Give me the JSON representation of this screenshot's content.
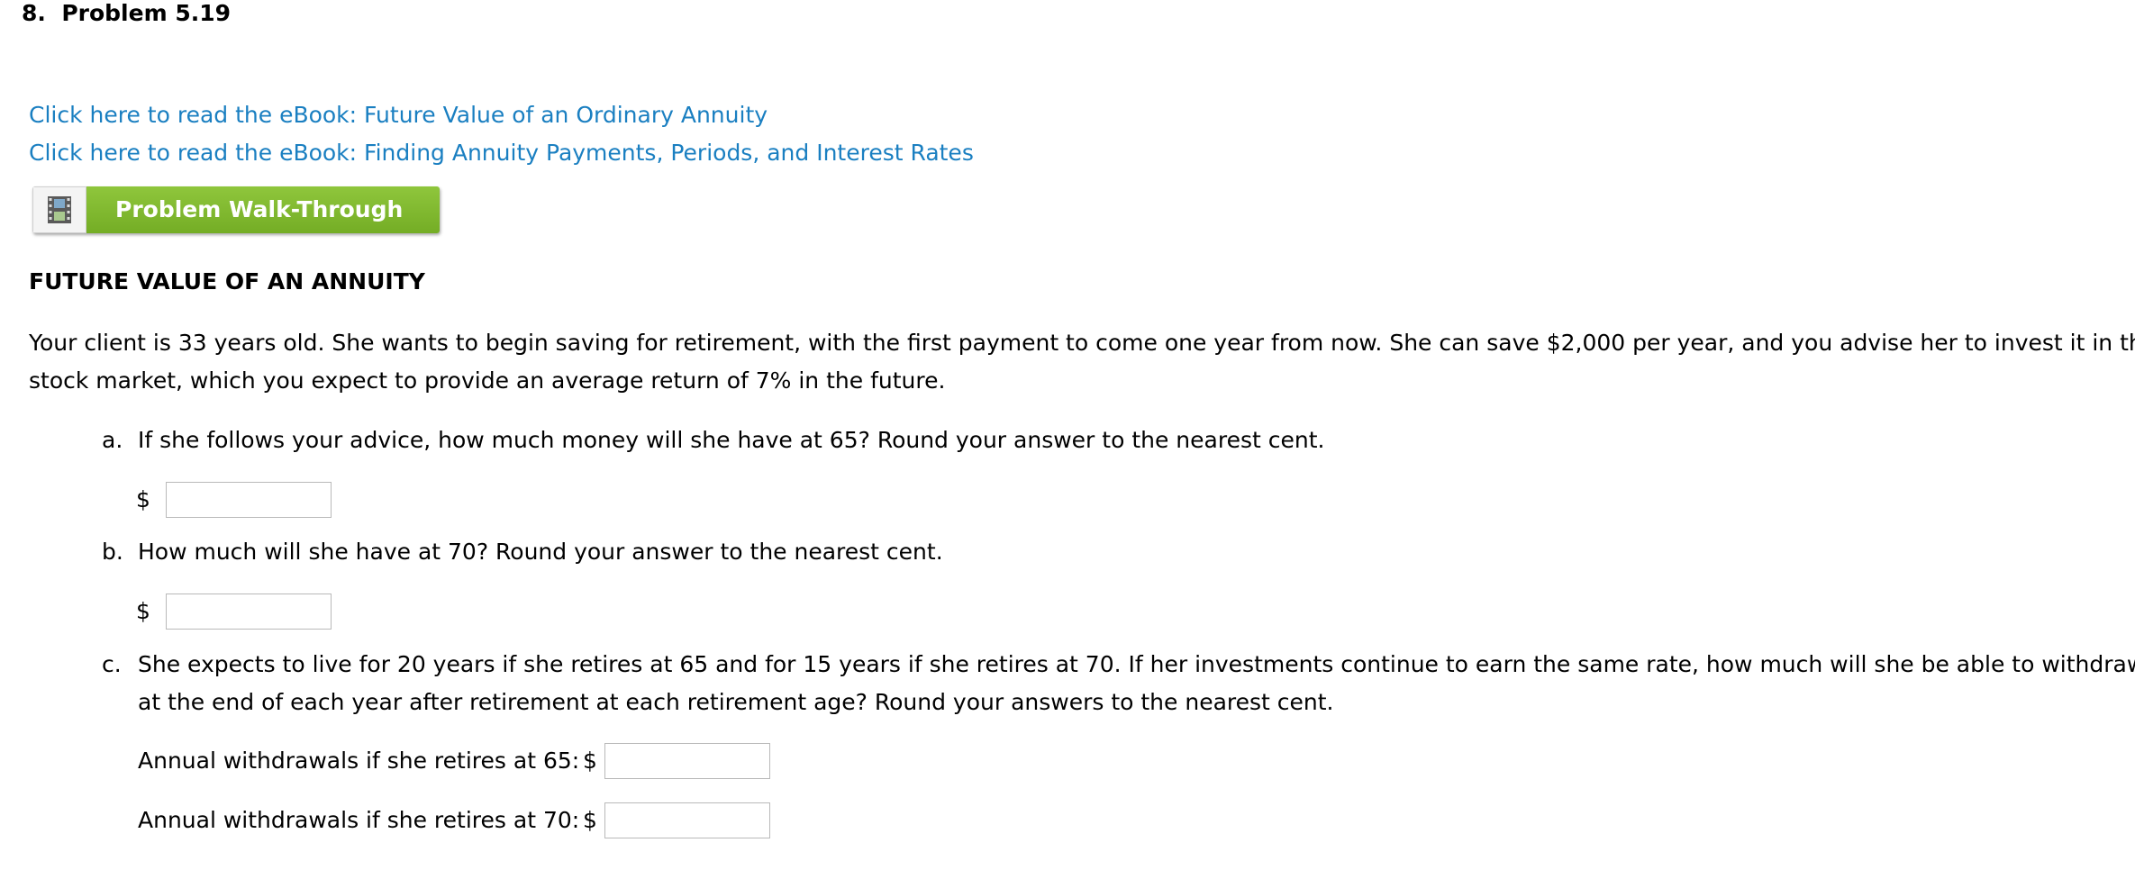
{
  "problem": {
    "number": "8.",
    "title": "Problem 5.19"
  },
  "links": [
    {
      "label": "Click here to read the eBook: Future Value of an Ordinary Annuity"
    },
    {
      "label": "Click here to read the eBook: Finding Annuity Payments, Periods, and Interest Rates"
    }
  ],
  "walkthrough": {
    "label": "Problem Walk-Through",
    "icon": "film-icon"
  },
  "section": {
    "heading": "FUTURE VALUE OF AN ANNUITY",
    "intro_line1": "Your client is 33 years old. She wants to begin saving for retirement, with the first payment to come one year from now. She can save $2,000 per year, and you advise her to invest it in the",
    "intro_line2": "stock market, which you expect to provide an average return of 7% in the future."
  },
  "questions": {
    "a": {
      "marker": "a.",
      "text": "If she follows your advice, how much money will she have at 65? Round your answer to the nearest cent.",
      "currency": "$",
      "value": ""
    },
    "b": {
      "marker": "b.",
      "text": "How much will she have at 70? Round your answer to the nearest cent.",
      "currency": "$",
      "value": ""
    },
    "c": {
      "marker": "c.",
      "text_line1": "She expects to live for 20 years if she retires at 65 and for 15 years if she retires at 70. If her investments continue to earn the same rate, how much will she be able to withdraw",
      "text_line2": "at the end of each year after retirement at each retirement age? Round your answers to the nearest cent.",
      "withdraw_65_label": "Annual withdrawals if she retires at 65:",
      "withdraw_70_label": "Annual withdrawals if she retires at 70:",
      "currency": "$",
      "value_65": "",
      "value_70": ""
    }
  },
  "colors": {
    "link": "#1a7fc1",
    "button_green": "#7ab52b"
  }
}
